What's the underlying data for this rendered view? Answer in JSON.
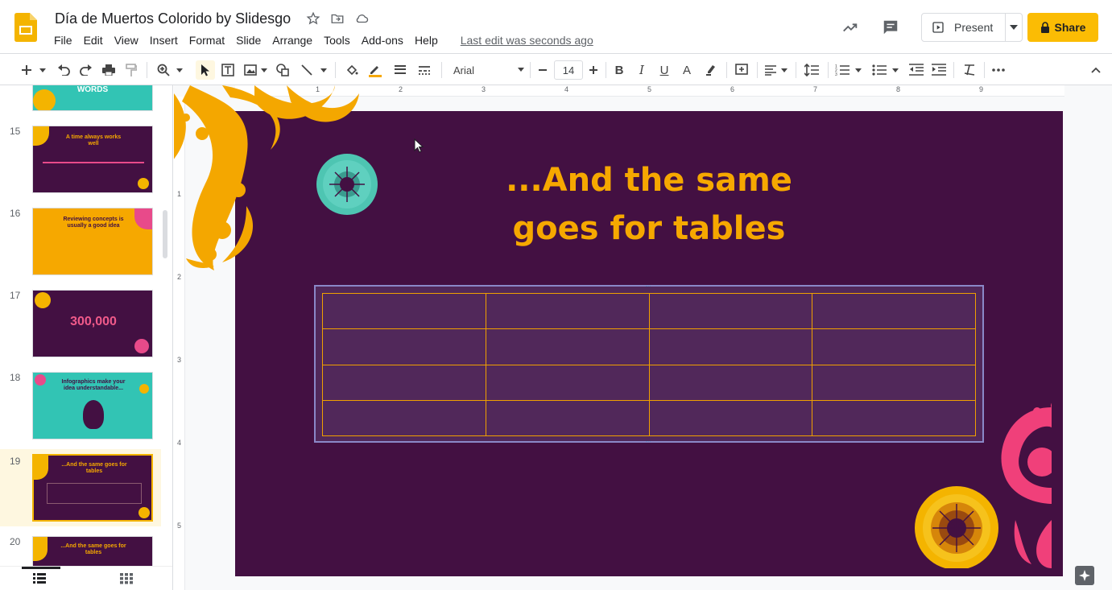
{
  "header": {
    "title": "Día de Muertos Colorido by Slidesgo",
    "menu": [
      "File",
      "Edit",
      "View",
      "Insert",
      "Format",
      "Slide",
      "Arrange",
      "Tools",
      "Add-ons",
      "Help"
    ],
    "last_edit": "Last edit was seconds ago",
    "present_label": "Present",
    "share_label": "Share"
  },
  "toolbar": {
    "font": "Arial",
    "font_size": "14"
  },
  "filmstrip": {
    "slides": [
      {
        "num": "",
        "title": "WORDS"
      },
      {
        "num": "15",
        "title": "A time always works well"
      },
      {
        "num": "16",
        "title": "Reviewing concepts is usually a good idea"
      },
      {
        "num": "17",
        "title": "300,000"
      },
      {
        "num": "18",
        "title": "Infographics make your idea understandable..."
      },
      {
        "num": "19",
        "title": "...And the same goes for tables"
      },
      {
        "num": "20",
        "title": "...And the same goes for tables"
      }
    ]
  },
  "ruler": {
    "h": [
      "1",
      "2",
      "3",
      "4",
      "5",
      "6",
      "7",
      "8",
      "9"
    ],
    "v": [
      "1",
      "2",
      "3",
      "4",
      "5"
    ]
  },
  "slide": {
    "title_line1": "...And the same",
    "title_line2": "goes for tables",
    "table_rows": 4,
    "table_cols": 4
  },
  "colors": {
    "slide_bg": "#431042",
    "title": "#f6a800",
    "share": "#fbbc04",
    "table_border": "#f0a000",
    "selection": "#8a88c8"
  }
}
